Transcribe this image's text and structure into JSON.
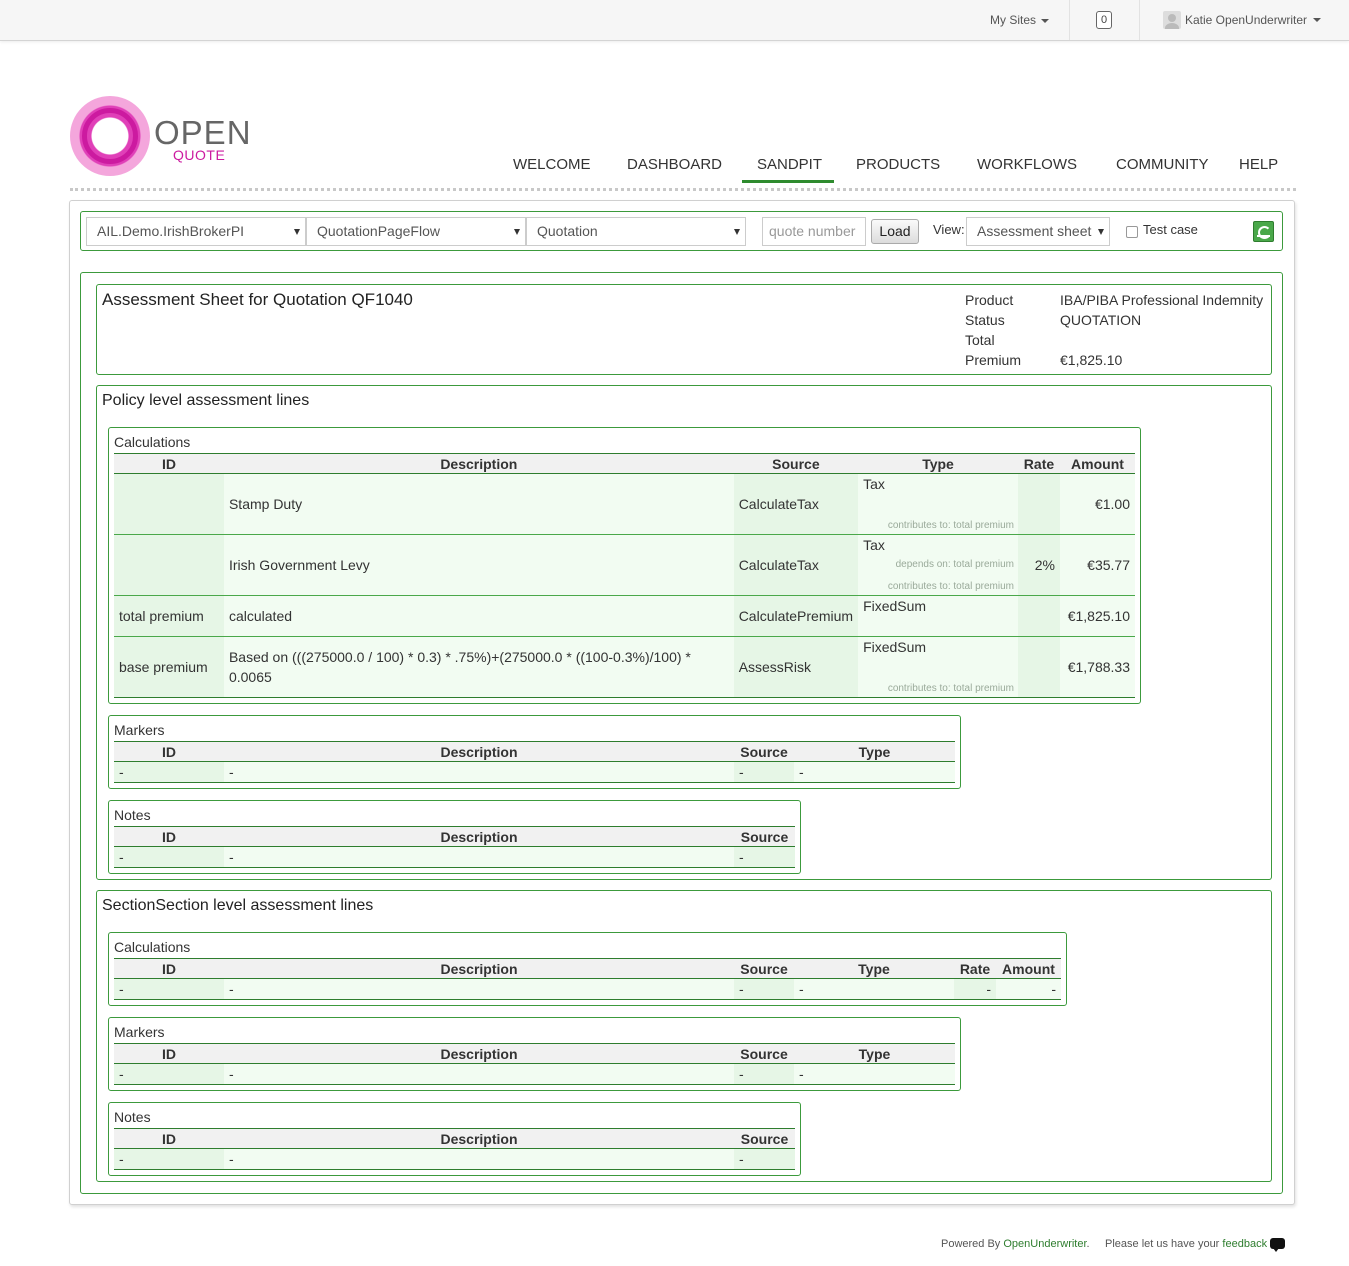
{
  "topbar": {
    "my_sites": "My Sites",
    "notifications": "0",
    "user": "Katie OpenUnderwriter"
  },
  "logo": {
    "open": "OPEN",
    "quote": "QUOTE"
  },
  "nav": [
    "WELCOME",
    "DASHBOARD",
    "SANDPIT",
    "PRODUCTS",
    "WORKFLOWS",
    "COMMUNITY",
    "HELP"
  ],
  "nav_active": "SANDPIT",
  "toolbar": {
    "product_select": "AIL.Demo.IrishBrokerPI",
    "pageflow_select": "QuotationPageFlow",
    "type_select": "Quotation",
    "quote_placeholder": "quote number",
    "load_label": "Load",
    "view_label": "View:",
    "view_select": "Assessment sheet",
    "test_case_label": "Test case"
  },
  "header": {
    "title": "Assessment Sheet for Quotation QF1040",
    "product_label": "Product",
    "product_value": "IBA/PIBA Professional Indemnity",
    "status_label": "Status",
    "status_value": "QUOTATION",
    "total_label": "Total",
    "premium_label": "Premium",
    "premium_value": "€1,825.10"
  },
  "policy": {
    "title": "Policy level assessment lines",
    "calculations": {
      "title": "Calculations",
      "headers": [
        "ID",
        "Description",
        "Source",
        "Type",
        "Rate",
        "Amount"
      ],
      "rows": [
        {
          "id": "",
          "description": "Stamp Duty",
          "source": "CalculateTax",
          "type": "Tax",
          "depends": "",
          "contributes": "contributes to: total premium",
          "rate": "",
          "amount": "€1.00"
        },
        {
          "id": "",
          "description": "Irish Government Levy",
          "source": "CalculateTax",
          "type": "Tax",
          "depends": "depends on: total premium",
          "contributes": "contributes to: total premium",
          "rate": "2%",
          "amount": "€35.77"
        },
        {
          "id": "total premium",
          "description": "calculated",
          "source": "CalculatePremium",
          "type": "FixedSum",
          "depends": "",
          "contributes": "",
          "rate": "",
          "amount": "€1,825.10"
        },
        {
          "id": "base premium",
          "description": "Based on (((275000.0 / 100) * 0.3) * .75%)+(275000.0 * ((100-0.3%)/100) * 0.0065",
          "source": "AssessRisk",
          "type": "FixedSum",
          "depends": "",
          "contributes": "contributes to: total premium",
          "rate": "",
          "amount": "€1,788.33"
        }
      ]
    },
    "markers": {
      "title": "Markers",
      "headers": [
        "ID",
        "Description",
        "Source",
        "Type"
      ],
      "row": [
        "-",
        "-",
        "-",
        "-"
      ]
    },
    "notes": {
      "title": "Notes",
      "headers": [
        "ID",
        "Description",
        "Source"
      ],
      "row": [
        "-",
        "-",
        "-"
      ]
    }
  },
  "section": {
    "title": "SectionSection level assessment lines",
    "calculations": {
      "title": "Calculations",
      "headers": [
        "ID",
        "Description",
        "Source",
        "Type",
        "Rate",
        "Amount"
      ],
      "row": [
        "-",
        "-",
        "-",
        "-",
        "-",
        "-"
      ]
    },
    "markers": {
      "title": "Markers",
      "headers": [
        "ID",
        "Description",
        "Source",
        "Type"
      ],
      "row": [
        "-",
        "-",
        "-",
        "-"
      ]
    },
    "notes": {
      "title": "Notes",
      "headers": [
        "ID",
        "Description",
        "Source"
      ],
      "row": [
        "-",
        "-",
        "-"
      ]
    }
  },
  "footer": {
    "powered_by": "Powered By",
    "powered_link": "OpenUnderwriter",
    "feedback_text": "Please let us have your",
    "feedback_link": "feedback"
  }
}
